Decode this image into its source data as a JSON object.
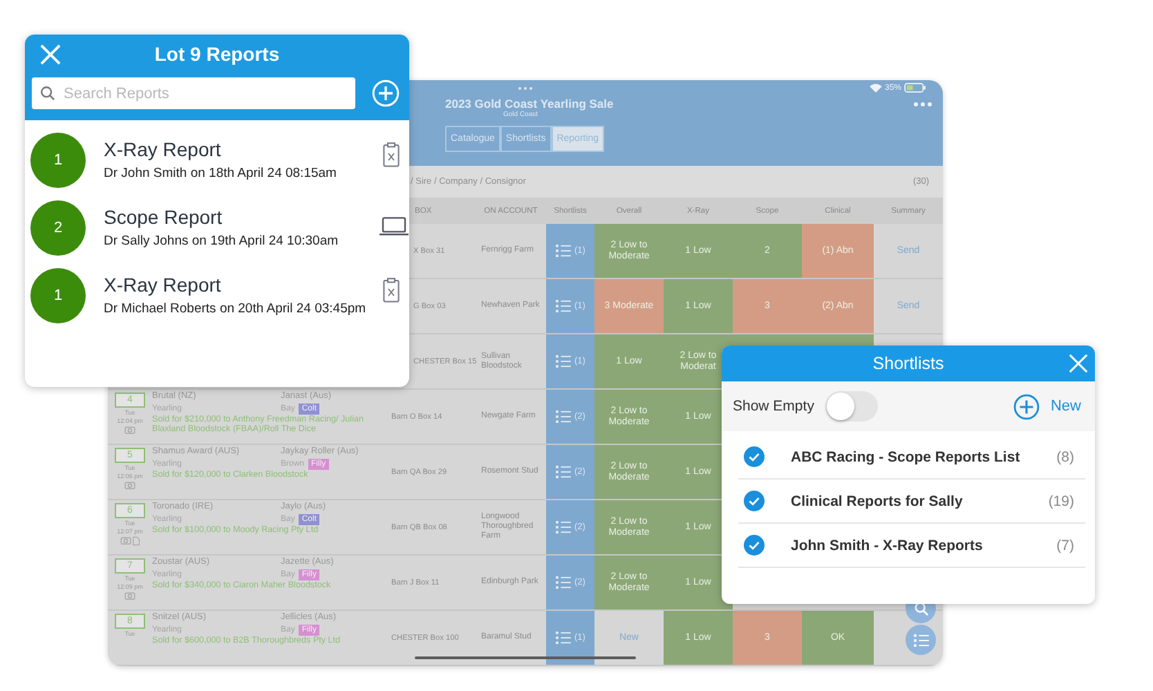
{
  "sale_window": {
    "battery": "35%",
    "title": "2023 Gold Coast Yearling Sale",
    "subtitle": "Gold Coast",
    "tabs": [
      {
        "label": "Catalogue",
        "selected": false
      },
      {
        "label": "Shortlists",
        "selected": false
      },
      {
        "label": "Reporting",
        "selected": true
      }
    ],
    "search": {
      "placeholder": "/ Sire / Company / Consignor"
    },
    "result_count": "(30)",
    "columns": [
      "BOX",
      "ON ACCOUNT",
      "Shortlists",
      "Overall",
      "X-Ray",
      "Scope",
      "Clinical",
      "Summary"
    ],
    "rows": [
      {
        "kind": "partial",
        "cells": [
          {
            "kind": "plain",
            "text": "X Box 31"
          },
          {
            "kind": "plain",
            "text": "Fernrigg Farm"
          },
          {
            "kind": "shortlist",
            "text": "(1)"
          },
          {
            "kind": "grade",
            "text": "2 Low to Moderate",
            "color": "#8ba776"
          },
          {
            "kind": "grade",
            "text": "1 Low",
            "color": "#8ba776"
          },
          {
            "kind": "grade",
            "text": "2",
            "color": "#8ba776"
          },
          {
            "kind": "grade",
            "text": "(1) Abn",
            "color": "#d49c84"
          },
          {
            "kind": "link",
            "text": "Send"
          }
        ]
      },
      {
        "kind": "partial",
        "cells": [
          {
            "kind": "plain",
            "text": "G Box 03"
          },
          {
            "kind": "plain",
            "text": "Newhaven Park"
          },
          {
            "kind": "shortlist",
            "text": "(1)"
          },
          {
            "kind": "grade",
            "text": "3 Moderate",
            "color": "#d49c84"
          },
          {
            "kind": "grade",
            "text": "1 Low",
            "color": "#8ba776"
          },
          {
            "kind": "grade",
            "text": "3",
            "color": "#d49c84"
          },
          {
            "kind": "grade",
            "text": "(2) Abn",
            "color": "#d49c84"
          },
          {
            "kind": "link",
            "text": "Send"
          }
        ]
      },
      {
        "kind": "partial",
        "cells": [
          {
            "kind": "plain",
            "text": "CHESTER Box 15"
          },
          {
            "kind": "plain",
            "text": "Sullivan Bloodstock"
          },
          {
            "kind": "shortlist",
            "text": "(1)"
          },
          {
            "kind": "grade",
            "text": "1 Low",
            "color": "#8ba776"
          },
          {
            "kind": "grade",
            "text": "2 Low to Moderat",
            "color": "#8ba776"
          },
          {
            "kind": "grade",
            "color": "#8ba776"
          },
          {
            "kind": "grade",
            "color": "#8ba776"
          }
        ]
      },
      {
        "kind": "full",
        "lot": "4",
        "day": "Tue",
        "time": "12:04 pm",
        "document": false,
        "horse": "Brutal (NZ)",
        "age": "Yearling",
        "dam": "Janast (Aus)",
        "colour": "Bay",
        "sex": {
          "label": "Colt",
          "color": "#9090d4"
        },
        "sold": "Sold for $210,000 to Anthony Freedman Racing/ Julian Blaxland Bloodstock (FBAA)/Roll The Dice",
        "cells": [
          {
            "kind": "plain",
            "text": "Barn O Box 14"
          },
          {
            "kind": "plain",
            "text": "Newgate Farm"
          },
          {
            "kind": "shortlist",
            "text": "(2)"
          },
          {
            "kind": "grade",
            "text": "2 Low to Moderate",
            "color": "#8ba776"
          },
          {
            "kind": "grade",
            "text": "1 Low",
            "color": "#8ba776"
          }
        ]
      },
      {
        "kind": "full",
        "lot": "5",
        "day": "Tue",
        "time": "12:06 pm",
        "document": false,
        "horse": "Shamus Award (AUS)",
        "age": "Yearling",
        "dam": "Jaykay Roller (Aus)",
        "colour": "Brown",
        "sex": {
          "label": "Filly",
          "color": "#d690d2"
        },
        "sold": "Sold for $120,000 to Clarken Bloodstock",
        "cells": [
          {
            "kind": "plain",
            "text": "Barn QA Box 29"
          },
          {
            "kind": "plain",
            "text": "Rosemont Stud"
          },
          {
            "kind": "shortlist",
            "text": "(2)"
          },
          {
            "kind": "grade",
            "text": "2 Low to Moderate",
            "color": "#8ba776"
          },
          {
            "kind": "grade",
            "text": "1 Low",
            "color": "#8ba776"
          }
        ]
      },
      {
        "kind": "full",
        "lot": "6",
        "day": "Tue",
        "time": "12:07 pm",
        "document": true,
        "horse": "Toronado (IRE)",
        "age": "Yearling",
        "dam": "Jaylo (Aus)",
        "colour": "Bay",
        "sex": {
          "label": "Colt",
          "color": "#9090d4"
        },
        "sold": "Sold for $100,000 to Moody Racing Pty Ltd",
        "cells": [
          {
            "kind": "plain",
            "text": "Barn QB Box 08"
          },
          {
            "kind": "plain",
            "text": "Longwood Thoroughbred Farm"
          },
          {
            "kind": "shortlist",
            "text": "(2)"
          },
          {
            "kind": "grade",
            "text": "2 Low to Moderate",
            "color": "#8ba776"
          },
          {
            "kind": "grade",
            "text": "1 Low",
            "color": "#8ba776"
          }
        ]
      },
      {
        "kind": "full",
        "lot": "7",
        "day": "Tue",
        "time": "12:09 pm",
        "document": false,
        "horse": "Zoustar (AUS)",
        "age": "Yearling",
        "dam": "Jazette (Aus)",
        "colour": "Bay",
        "sex": {
          "label": "Filly",
          "color": "#d690d2"
        },
        "sold": "Sold for $340,000 to Ciaron Maher Bloodstock",
        "cells": [
          {
            "kind": "plain",
            "text": "Barn J Box 11"
          },
          {
            "kind": "plain",
            "text": "Edinburgh Park"
          },
          {
            "kind": "shortlist",
            "text": "(2)"
          },
          {
            "kind": "grade",
            "text": "2 Low to Moderate",
            "color": "#8ba776"
          },
          {
            "kind": "grade",
            "text": "1 Low",
            "color": "#8ba776"
          }
        ]
      },
      {
        "kind": "full",
        "lot": "8",
        "day": "Tue",
        "horse": "Snitzel (AUS)",
        "age": "Yearling",
        "dam": "Jellicles (Aus)",
        "colour": "Bay",
        "sex": {
          "label": "Filly",
          "color": "#d690d2"
        },
        "sold": "Sold for $600,000 to B2B Thoroughbreds Pty Ltd",
        "cells": [
          {
            "kind": "plain",
            "text": "CHESTER Box 100"
          },
          {
            "kind": "plain",
            "text": "Baramul Stud"
          },
          {
            "kind": "shortlist",
            "text": "(1)"
          },
          {
            "kind": "link",
            "text": "New",
            "color": "#d6d6d6"
          },
          {
            "kind": "grade",
            "text": "1 Low",
            "color": "#8ba776"
          },
          {
            "kind": "grade",
            "text": "3",
            "color": "#d49c84"
          },
          {
            "kind": "grade",
            "text": "OK",
            "color": "#8ba776"
          }
        ]
      }
    ]
  },
  "reports_popup": {
    "title": "Lot 9 Reports",
    "search": {
      "placeholder": "Search Reports"
    },
    "items": [
      {
        "kind": "xray",
        "count": "1",
        "title": "X-Ray Report",
        "byline": "Dr John Smith on 18th April 24 08:15am"
      },
      {
        "kind": "scope",
        "count": "2",
        "title": "Scope Report",
        "byline": "Dr Sally Johns on 19th April 24 10:30am"
      },
      {
        "kind": "xray",
        "count": "1",
        "title": "X-Ray Report",
        "byline": "Dr Michael Roberts on 20th April 24 03:45pm"
      }
    ]
  },
  "shortlists_popup": {
    "title": "Shortlists",
    "show_empty": {
      "label": "Show Empty",
      "on": false
    },
    "new_label": "New",
    "items": [
      {
        "name": "ABC Racing - Scope Reports List",
        "count": "(8)",
        "checked": true
      },
      {
        "name": "Clinical Reports for Sally",
        "count": "(19)",
        "checked": true
      },
      {
        "name": "John Smith - X-Ray Reports",
        "count": "(7)",
        "checked": true
      }
    ]
  }
}
